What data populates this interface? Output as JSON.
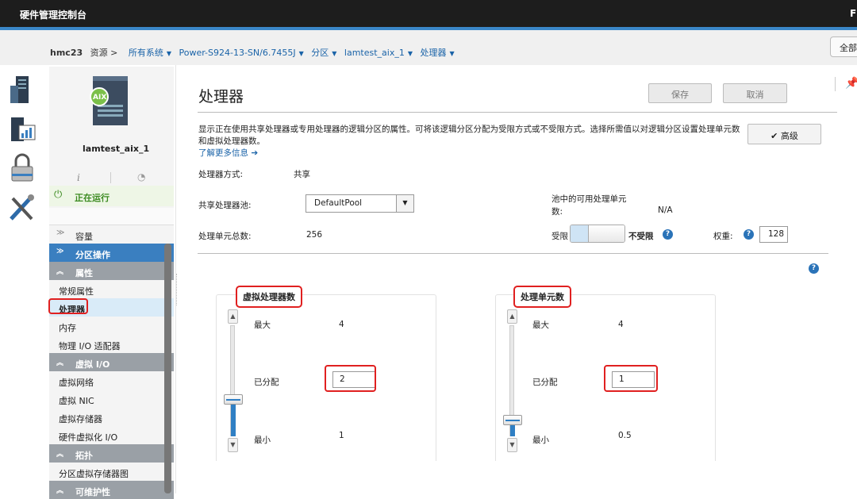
{
  "app": {
    "title": "硬件管理控制台",
    "user_fragment": "F"
  },
  "breadcrumb": {
    "host": "hmc23",
    "resources": "资源 >",
    "items": [
      "所有系统",
      "Power-S924-13-SN/6.7455J",
      "分区",
      "lamtest_aix_1",
      "处理器"
    ]
  },
  "header": {
    "all_button": "全部"
  },
  "partition": {
    "logo_text": "AIX",
    "name": "lamtest_aix_1",
    "status": "正在运行"
  },
  "nav": {
    "capacity": "容量",
    "partition_ops": "分区操作",
    "properties": "属性",
    "items_props": [
      "常规属性",
      "处理器",
      "内存",
      "物理 I/O 适配器"
    ],
    "virtual_io": "虚拟 I/O",
    "items_vio": [
      "虚拟网络",
      "虚拟 NIC",
      "虚拟存储器",
      "硬件虚拟化 I/O"
    ],
    "topology": "拓扑",
    "items_topo": [
      "分区虚拟存储器图"
    ],
    "serviceability": "可维护性"
  },
  "main": {
    "title": "处理器",
    "save": "保存",
    "cancel": "取消",
    "description": "显示正在使用共享处理器或专用处理器的逻辑分区的属性。可将该逻辑分区分配为受限方式或不受限方式。选择所需值以对逻辑分区设置处理单元数和虚拟处理器数。",
    "learn_more": "了解更多信息 ➔",
    "advanced": "✔ 高级",
    "mode_label": "处理器方式:",
    "mode_value": "共享",
    "pool_label": "共享处理器池:",
    "pool_value": "DefaultPool",
    "available_label_1": "池中的可用处理单元",
    "available_label_2": "数:",
    "available_value": "N/A",
    "total_label": "处理单元总数:",
    "total_value": "256",
    "capped": "受限",
    "uncapped": "不受限",
    "weight_label": "权重:",
    "weight_value": "128"
  },
  "virtual_processors": {
    "title": "虚拟处理器数",
    "max_label": "最大",
    "max_value": "4",
    "assigned_label": "已分配",
    "assigned_value": "2",
    "min_label": "最小",
    "min_value": "1",
    "level": 0.33
  },
  "processing_units": {
    "title": "处理单元数",
    "max_label": "最大",
    "max_value": "4",
    "assigned_label": "已分配",
    "assigned_value": "1",
    "min_label": "最小",
    "min_value": "0.5",
    "level": 0.14
  },
  "colors": {
    "accent": "#3a7fc0",
    "highlight": "#e02020",
    "running": "#3b8a20"
  }
}
